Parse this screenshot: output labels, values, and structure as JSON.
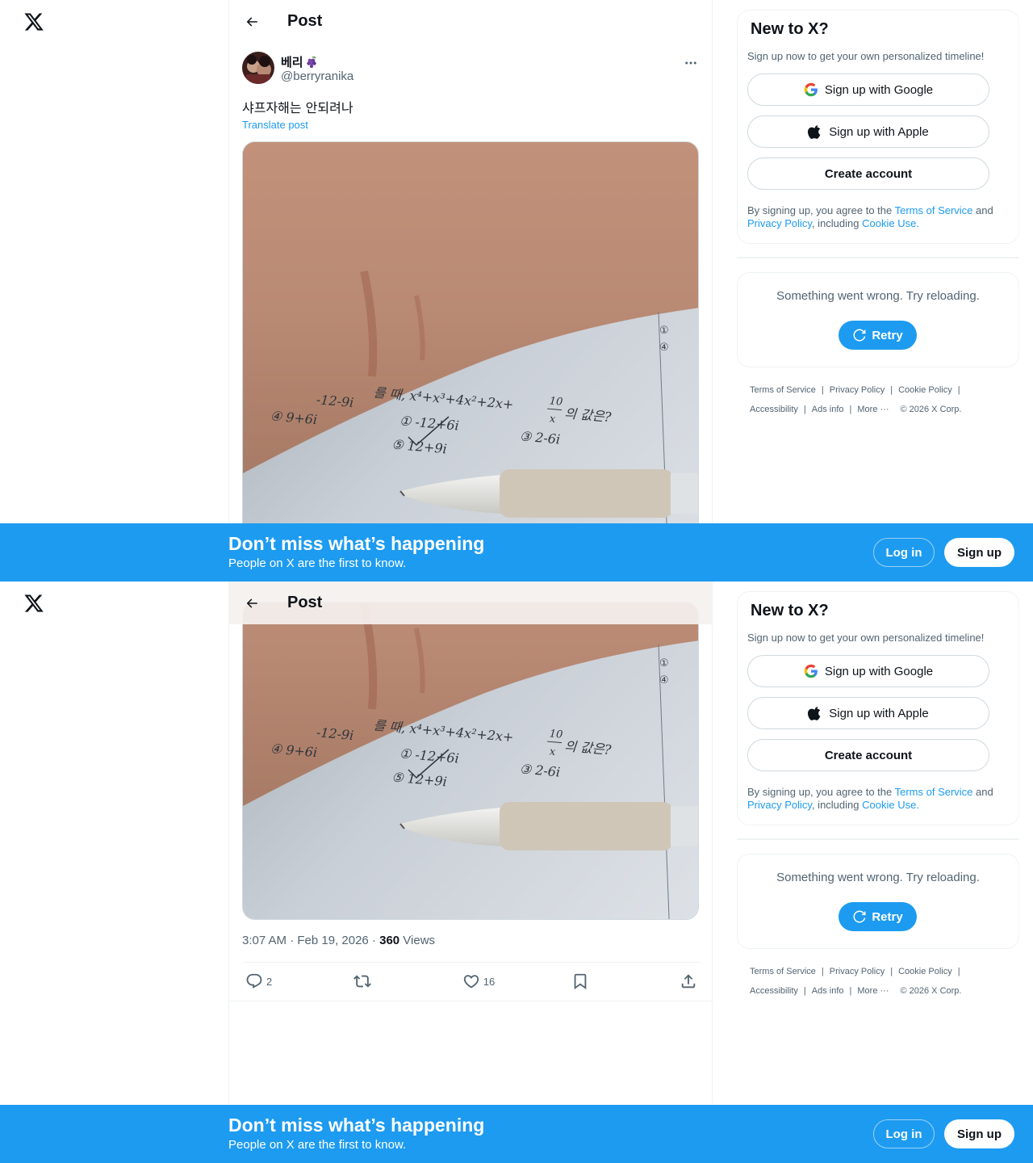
{
  "header": {
    "title": "Post"
  },
  "post": {
    "author_name": "베리",
    "author_handle": "@berryranika",
    "text": "샤프자해는 안되려나",
    "translate_label": "Translate post",
    "time": "3:07 AM · Feb 19, 2026 · ",
    "views_count": "360",
    "views_label": " Views",
    "replies": "2",
    "reposts": "",
    "likes": "16"
  },
  "math_text": {
    "line1": "를 때, x⁴+x³+4x²+2x+",
    "fraction_num": "10",
    "fraction_den": "x",
    "line1_end": "의 값은?",
    "opt_a": "-12-9i",
    "opt_b": "① -12+6i",
    "opt_c": "③ 2-6i",
    "opt_d": "④ 9+6i",
    "opt_e": "⑤ 12+9i",
    "circ1": "①",
    "circ4": "④"
  },
  "sidebar": {
    "new_title": "New to X?",
    "new_sub": "Sign up now to get your own personalized timeline!",
    "google_label": "Sign up with Google",
    "apple_label": "Sign up with Apple",
    "create_label": "Create account",
    "legal_prefix": "By signing up, you agree to the ",
    "terms_link": "Terms of Service",
    "legal_and": " and ",
    "privacy_link": "Privacy Policy",
    "legal_including": ", including ",
    "cookie_link": "Cookie Use.",
    "error_text": "Something went wrong. Try reloading.",
    "retry_label": "Retry"
  },
  "footer": {
    "terms": "Terms of Service",
    "privacy": "Privacy Policy",
    "cookie": "Cookie Policy",
    "accessibility": "Accessibility",
    "ads": "Ads info",
    "more": "More ···",
    "copyright": "© 2026 X Corp.",
    "sep": "|"
  },
  "banner": {
    "title": "Don’t miss what’s happening",
    "subtitle": "People on X are the first to know.",
    "login": "Log in",
    "signup": "Sign up"
  },
  "colors": {
    "accent": "#1d9bf0",
    "text_primary": "#0f1419",
    "text_secondary": "#536471",
    "border": "#eff3f4"
  }
}
